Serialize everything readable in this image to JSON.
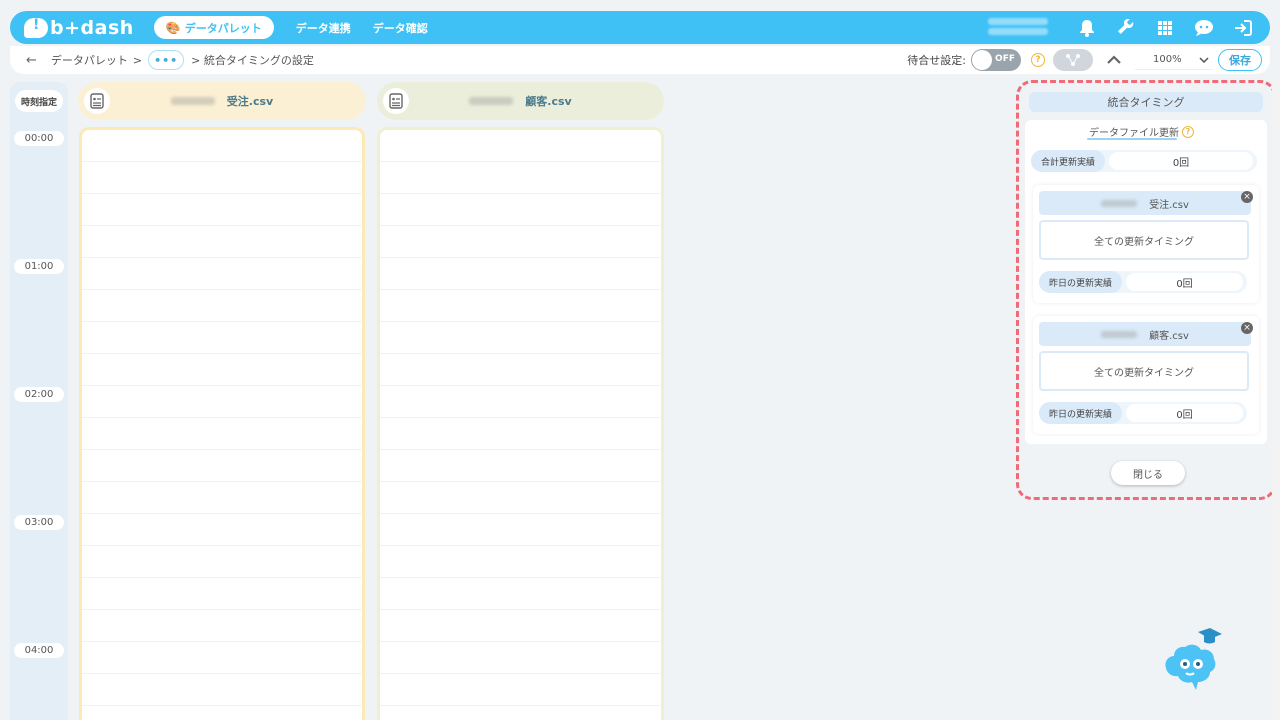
{
  "header": {
    "logo": "b+dash",
    "nav_active": "データパレット",
    "nav_items": [
      "データ連携",
      "データ確認"
    ]
  },
  "toolbar": {
    "back": "←",
    "crumb_root": "データパレット",
    "sep1": ">",
    "dots": "•••",
    "current": "> 統合タイミングの設定",
    "wait_label": "待合せ設定:",
    "toggle_text": "OFF",
    "help": "?",
    "zoom": "100%",
    "save": "保存"
  },
  "time": {
    "head": "時刻指定",
    "labels": [
      "00:00",
      "01:00",
      "02:00",
      "03:00",
      "04:00"
    ]
  },
  "columns": [
    {
      "name": "受注.csv",
      "color": "#fbf0d4",
      "border": "#fbe9b8"
    },
    {
      "name": "顧客.csv",
      "color": "#ebeedb",
      "border": "#eef0d2"
    }
  ],
  "panel": {
    "title": "統合タイミング",
    "subtitle": "データファイル更新",
    "total_label": "合計更新実績",
    "total_value": "0回",
    "cards": [
      {
        "name": "受注.csv",
        "timing": "全ての更新タイミング",
        "yesterday_label": "昨日の更新実績",
        "yesterday_value": "0回"
      },
      {
        "name": "顧客.csv",
        "timing": "全ての更新タイミング",
        "yesterday_label": "昨日の更新実績",
        "yesterday_value": "0回"
      }
    ],
    "close": "閉じる"
  },
  "colors": {
    "accent": "#3fc1f5",
    "highlight": "#ee6b77"
  }
}
